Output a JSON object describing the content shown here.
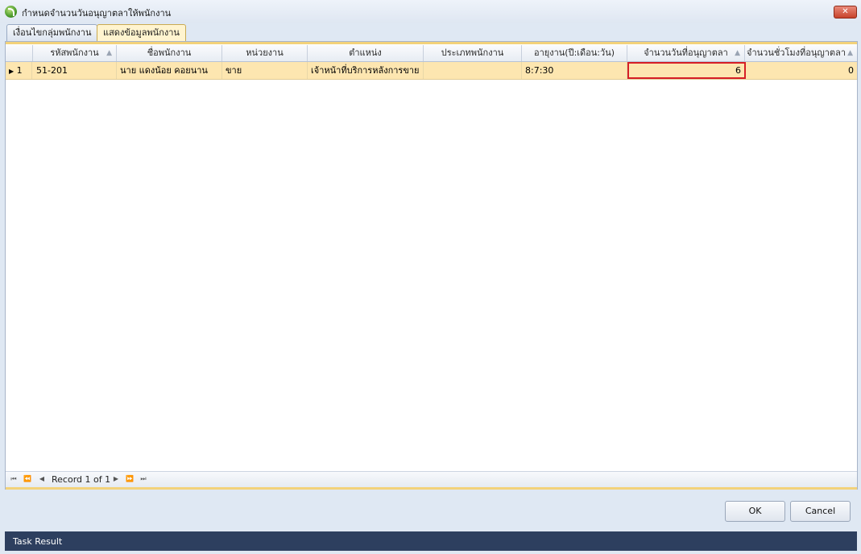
{
  "window": {
    "title": "กำหนดจำนวนวันอนุญาตลาให้พนักงาน",
    "close_label": "✕"
  },
  "tabs": [
    {
      "label": "เงื่อนไขกลุ่มพนักงาน",
      "active": false
    },
    {
      "label": "แสดงข้อมูลพนักงาน",
      "active": true
    }
  ],
  "grid": {
    "columns": [
      "รหัสพนักงาน",
      "ชื่อพนักงาน",
      "หน่วยงาน",
      "ตำแหน่ง",
      "ประเภทพนักงาน",
      "อายุงาน(ปี:เดือน:วัน)",
      "จำนวนวันที่อนุญาตลา",
      "จำนวนชั่วโมงที่อนุญาตลา"
    ],
    "rows": [
      {
        "row_number": "1",
        "employee_id": "51-201",
        "name": "นาย แดงน้อย คอยนาน",
        "department": "ขาย",
        "position": "เจ้าหน้าที่บริการหลังการขาย",
        "employee_type": "",
        "service_period": "8:7:30",
        "allowed_days": "6",
        "allowed_hours": "0"
      }
    ],
    "navigator": {
      "record_text": "Record 1 of 1"
    }
  },
  "buttons": {
    "ok": "OK",
    "cancel": "Cancel"
  },
  "status": {
    "text": "Task Result"
  },
  "colors": {
    "selected_row": "#fde6b0",
    "highlight_border": "#d61f26",
    "status_bar": "#2d3f5f"
  }
}
